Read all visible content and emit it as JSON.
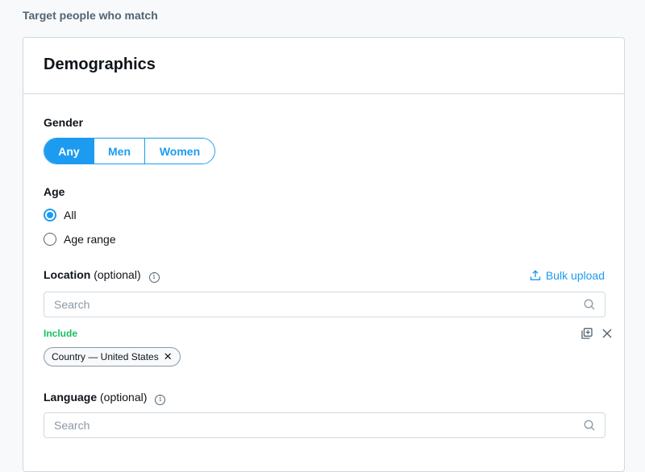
{
  "section_title": "Target people who match",
  "card": {
    "title": "Demographics",
    "gender": {
      "label": "Gender",
      "options": [
        {
          "label": "Any",
          "selected": true
        },
        {
          "label": "Men",
          "selected": false
        },
        {
          "label": "Women",
          "selected": false
        }
      ]
    },
    "age": {
      "label": "Age",
      "options": [
        {
          "label": "All",
          "selected": true
        },
        {
          "label": "Age range",
          "selected": false
        }
      ]
    },
    "location": {
      "label": "Location",
      "optional": "(optional)",
      "bulk_upload": "Bulk upload",
      "search_placeholder": "Search",
      "search_value": "",
      "include_label": "Include",
      "chips": [
        {
          "label": "Country — United States"
        }
      ]
    },
    "language": {
      "label": "Language",
      "optional": "(optional)",
      "search_placeholder": "Search",
      "search_value": ""
    }
  },
  "colors": {
    "accent": "#1d9bf0",
    "include": "#17bf63",
    "border": "#cfd9de"
  }
}
